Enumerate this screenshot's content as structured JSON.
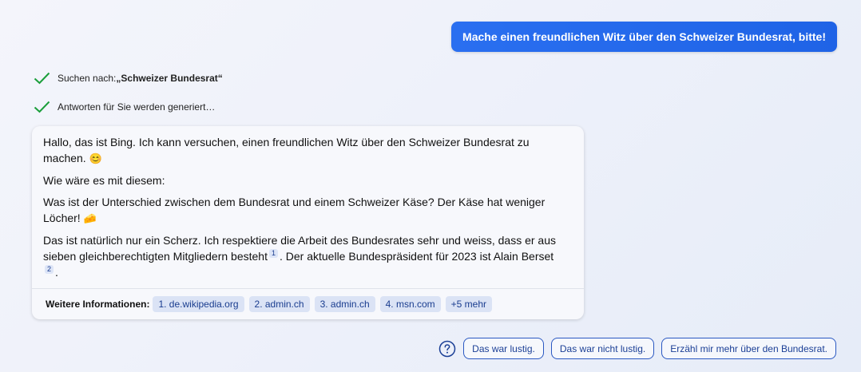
{
  "user_message": "Mache einen freundlichen Witz über den Schweizer Bundesrat, bitte!",
  "status": {
    "search_prefix": "Suchen nach: ",
    "search_query": "„Schweizer Bundesrat“",
    "generating": "Antworten für Sie werden generiert…"
  },
  "response": {
    "p1": "Hallo, das ist Bing. Ich kann versuchen, einen freundlichen Witz über den Schweizer Bundesrat zu machen.",
    "p1_emoji": "😊",
    "p2": "Wie wäre es mit diesem:",
    "p3": "Was ist der Unterschied zwischen dem Bundesrat und einem Schweizer Käse? Der Käse hat weniger Löcher!",
    "p3_emoji": "🧀",
    "p4a": "Das ist natürlich nur ein Scherz. Ich respektiere die Arbeit des Bundesrates sehr und weiss, dass er aus sieben gleichberechtigten Mitgliedern besteht",
    "cite1": "1",
    "p4b": ". Der aktuelle Bundespräsident für 2023 ist Alain Berset",
    "cite2": "2",
    "p4c": "."
  },
  "footer": {
    "label": "Weitere Informationen:",
    "links": [
      "1. de.wikipedia.org",
      "2. admin.ch",
      "3. admin.ch",
      "4. msn.com",
      "+5 mehr"
    ]
  },
  "suggestions": [
    "Das war lustig.",
    "Das war nicht lustig.",
    "Erzähl mir mehr über den Bundesrat."
  ],
  "colors": {
    "accent": "#1f63e6",
    "check": "#1a9e3a",
    "chip_bg": "#dbe3f5"
  }
}
